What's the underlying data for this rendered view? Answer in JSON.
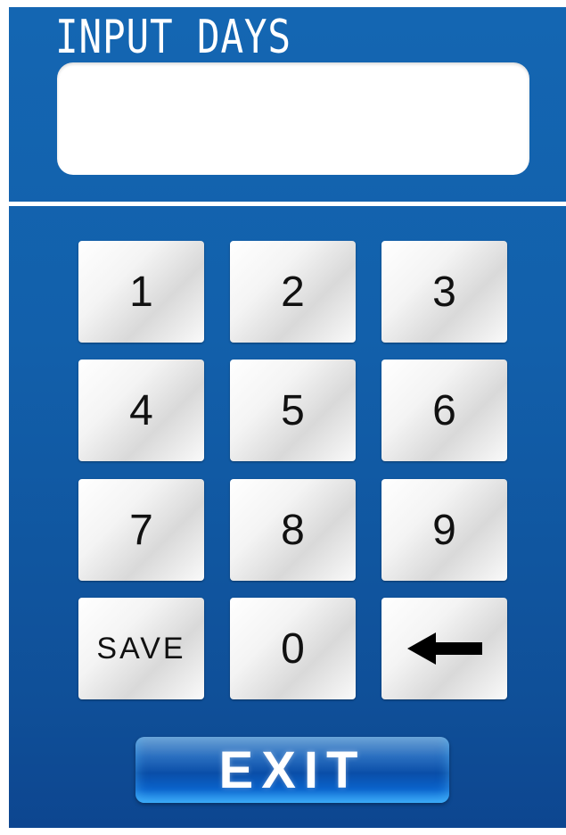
{
  "screen": {
    "title": "INPUT DAYS",
    "display_value": ""
  },
  "keypad": {
    "k1": "1",
    "k2": "2",
    "k3": "3",
    "k4": "4",
    "k5": "5",
    "k6": "6",
    "k7": "7",
    "k8": "8",
    "k9": "9",
    "save": "SAVE",
    "k0": "0",
    "backspace_icon": "left-arrow-icon"
  },
  "footer": {
    "exit": "EXIT"
  },
  "colors": {
    "background": "#1466b2",
    "accent": "#0a63cc",
    "key_face": "#f4f4f4"
  }
}
